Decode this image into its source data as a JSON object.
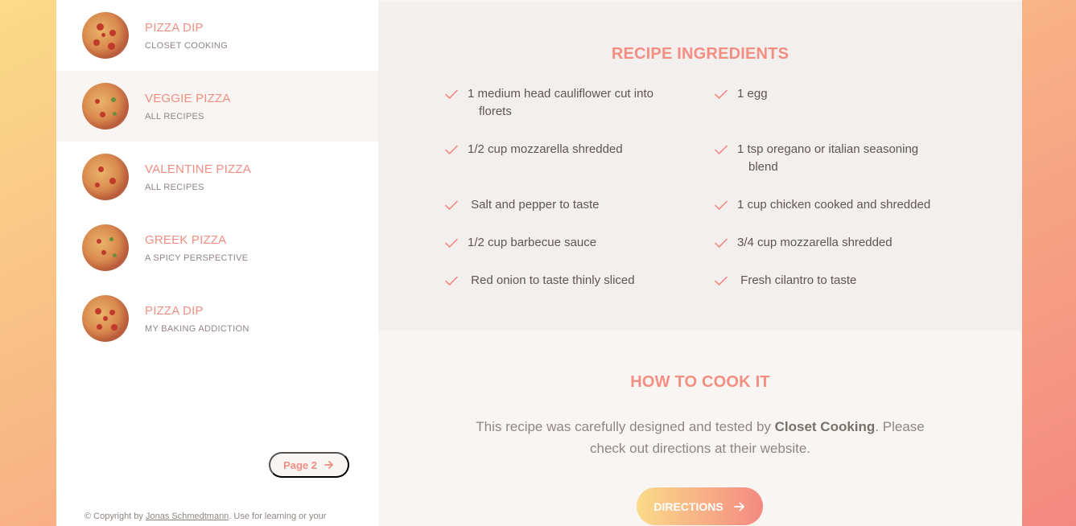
{
  "results": [
    {
      "title": "Pizza Dip",
      "publisher": "Closet Cooking",
      "active": false
    },
    {
      "title": "Veggie Pizza",
      "publisher": "All Recipes",
      "active": true
    },
    {
      "title": "Valentine Pizza",
      "publisher": "All Recipes",
      "active": false
    },
    {
      "title": "Greek Pizza",
      "publisher": "A Spicy Perspective",
      "active": false
    },
    {
      "title": "Pizza Dip",
      "publisher": "My Baking Addiction",
      "active": false
    }
  ],
  "pagination": {
    "label": "Page 2"
  },
  "footer": {
    "prefix": "© Copyright by ",
    "author": "Jonas Schmedtmann",
    "suffix": ". Use for learning or your"
  },
  "ingredients": {
    "heading": "Recipe Ingredients",
    "items": [
      {
        "line1": "1 medium head cauliflower cut into",
        "line2": "florets"
      },
      {
        "line1": "1 egg",
        "line2": ""
      },
      {
        "line1": "1/2 cup mozzarella shredded",
        "line2": ""
      },
      {
        "line1": "1 tsp oregano or italian seasoning",
        "line2": "blend"
      },
      {
        "line1": " Salt and pepper to taste",
        "line2": ""
      },
      {
        "line1": "1 cup chicken cooked and shredded",
        "line2": ""
      },
      {
        "line1": "1/2 cup barbecue sauce",
        "line2": ""
      },
      {
        "line1": "3/4 cup mozzarella shredded",
        "line2": ""
      },
      {
        "line1": " Red onion to taste thinly sliced",
        "line2": ""
      },
      {
        "line1": " Fresh cilantro to taste",
        "line2": ""
      }
    ]
  },
  "cook": {
    "heading": "How to cook it",
    "desc_prefix": "This recipe was carefully designed and tested by ",
    "publisher": "Closet Cooking",
    "desc_suffix": ". Please check out directions at their website.",
    "button_label": "Directions"
  },
  "colors": {
    "accent": "#f38e82",
    "grad_start": "#fbdb89",
    "grad_end": "#f48982"
  },
  "icons": {
    "check": "check-icon",
    "arrow": "arrow-right-icon"
  }
}
